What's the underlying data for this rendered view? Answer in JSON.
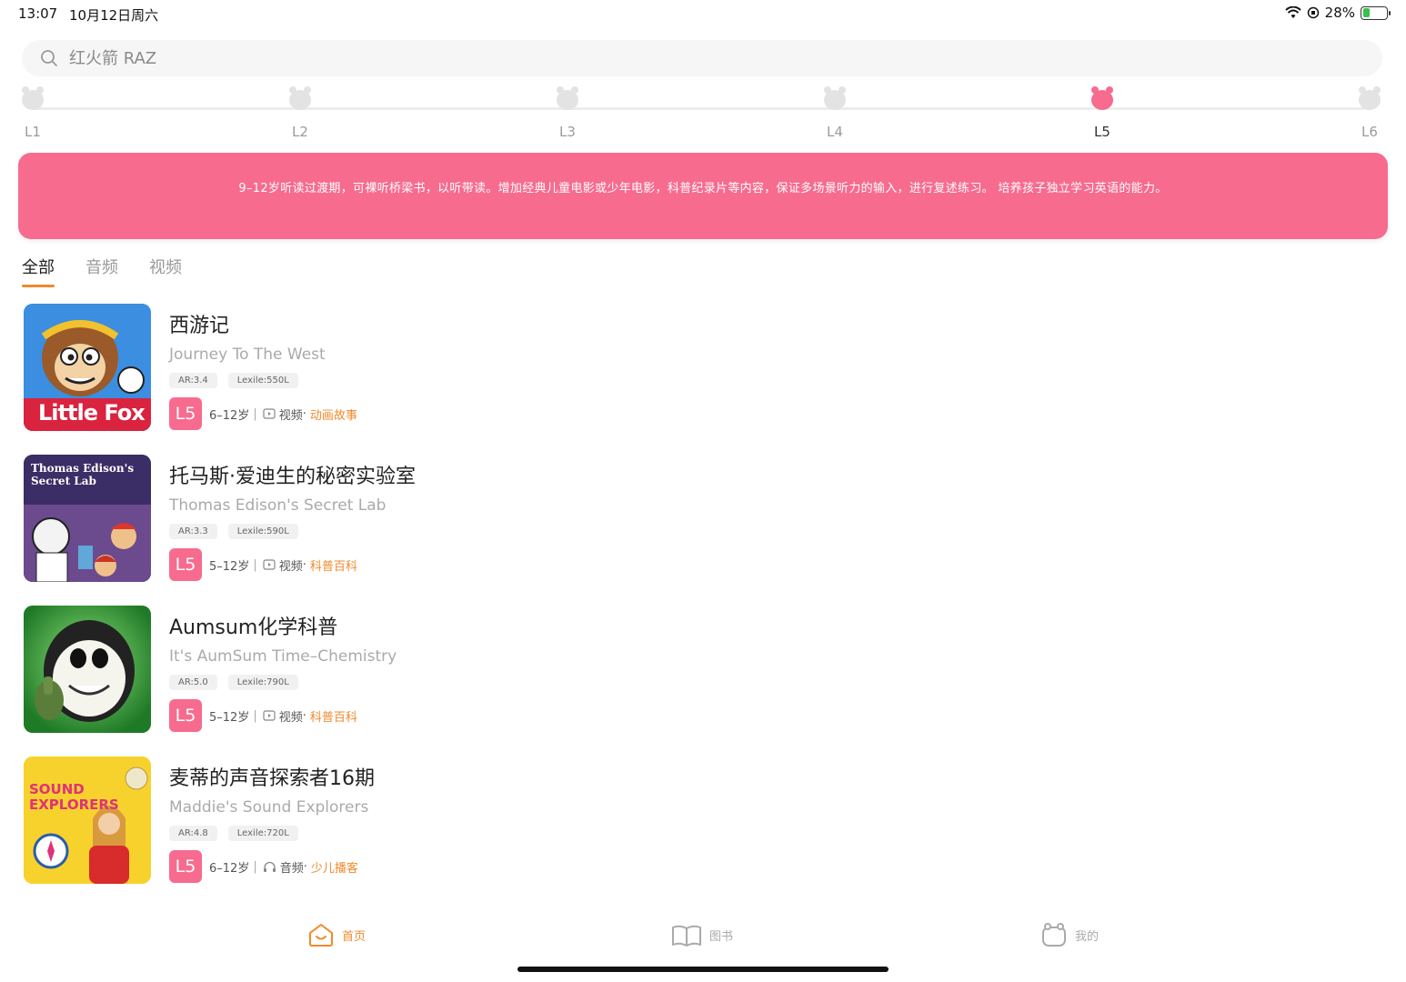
{
  "status": {
    "time": "13:07",
    "date": "10月12日周六",
    "battery": "28%",
    "battery_level": 0.28
  },
  "search": {
    "placeholder": "红火箭 RAZ"
  },
  "levels": {
    "items": [
      "L1",
      "L2",
      "L3",
      "L4",
      "L5",
      "L6"
    ],
    "active": "L5",
    "active_color": "#f76b8f",
    "inactive_color": "#e3e3e3"
  },
  "banner": {
    "text": "9–12岁听读过渡期，可裸听桥梁书，以听带读。增加经典儿童电影或少年电影，科普纪录片等内容，保证多场景听力的输入，进行复述练习。 培养孩子独立学习英语的能力。",
    "color": "#f76b8f"
  },
  "tabs": {
    "all": "全部",
    "audio": "音频",
    "video": "视频"
  },
  "items": [
    {
      "title": "西游记",
      "subtitle": "Journey To The West",
      "ar": "AR:3.4",
      "lexile": "Lexile:550L",
      "level": "L5",
      "age": "6–12岁",
      "media": "视频",
      "category": "动画故事",
      "thumb_label": "Little Fox"
    },
    {
      "title": "托马斯·爱迪生的秘密实验室",
      "subtitle": "Thomas Edison's Secret Lab",
      "ar": "AR:3.3",
      "lexile": "Lexile:590L",
      "level": "L5",
      "age": "5–12岁",
      "media": "视频",
      "category": "科普百科",
      "thumb_label": "Thomas Edison's Secret Lab"
    },
    {
      "title": "Aumsum化学科普",
      "subtitle": "It's AumSum Time–Chemistry",
      "ar": "AR:5.0",
      "lexile": "Lexile:790L",
      "level": "L5",
      "age": "5–12岁",
      "media": "视频",
      "category": "科普百科",
      "thumb_label": ""
    },
    {
      "title": "麦蒂的声音探索者16期",
      "subtitle": "Maddie's Sound Explorers",
      "ar": "AR:4.8",
      "lexile": "Lexile:720L",
      "level": "L5",
      "age": "6–12岁",
      "media": "音频",
      "category": "少儿播客",
      "thumb_label": "SOUND EXPLORERS"
    }
  ],
  "nav": {
    "home": "首页",
    "books": "图书",
    "mine": "我的"
  },
  "colors": {
    "accent": "#f08a2c",
    "pink": "#f76b8f"
  }
}
